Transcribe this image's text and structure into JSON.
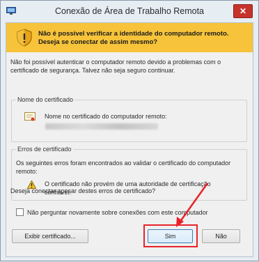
{
  "window": {
    "title": "Conexão de Área de Trabalho Remota",
    "close_glyph": "✕"
  },
  "banner": {
    "text": "Não é possível verificar a identidade do computador remoto. Deseja se conectar de assim mesmo?",
    "color": "#f6c33a"
  },
  "intro": "Não foi possível autenticar o computador remoto devido a problemas com o certificado de segurança. Talvez não seja seguro continuar.",
  "certificate": {
    "group_label": "Nome do certificado",
    "field_label": "Nome no certificado do computador remoto:"
  },
  "errors": {
    "group_label": "Erros de certificado",
    "description": "Os seguintes erros foram encontrados ao validar o certificado do computador remoto:",
    "item": "O certificado não provém de uma autoridade de certificação confiável."
  },
  "question": "Deseja conectar apesar destes erros de certificado?",
  "checkbox": {
    "label": "Não perguntar novamente sobre conexões com este computador",
    "checked": false
  },
  "buttons": {
    "view_certificate": "Exibir certificado...",
    "yes": "Sim",
    "no": "Não"
  },
  "annotation_color": "#e8222a"
}
